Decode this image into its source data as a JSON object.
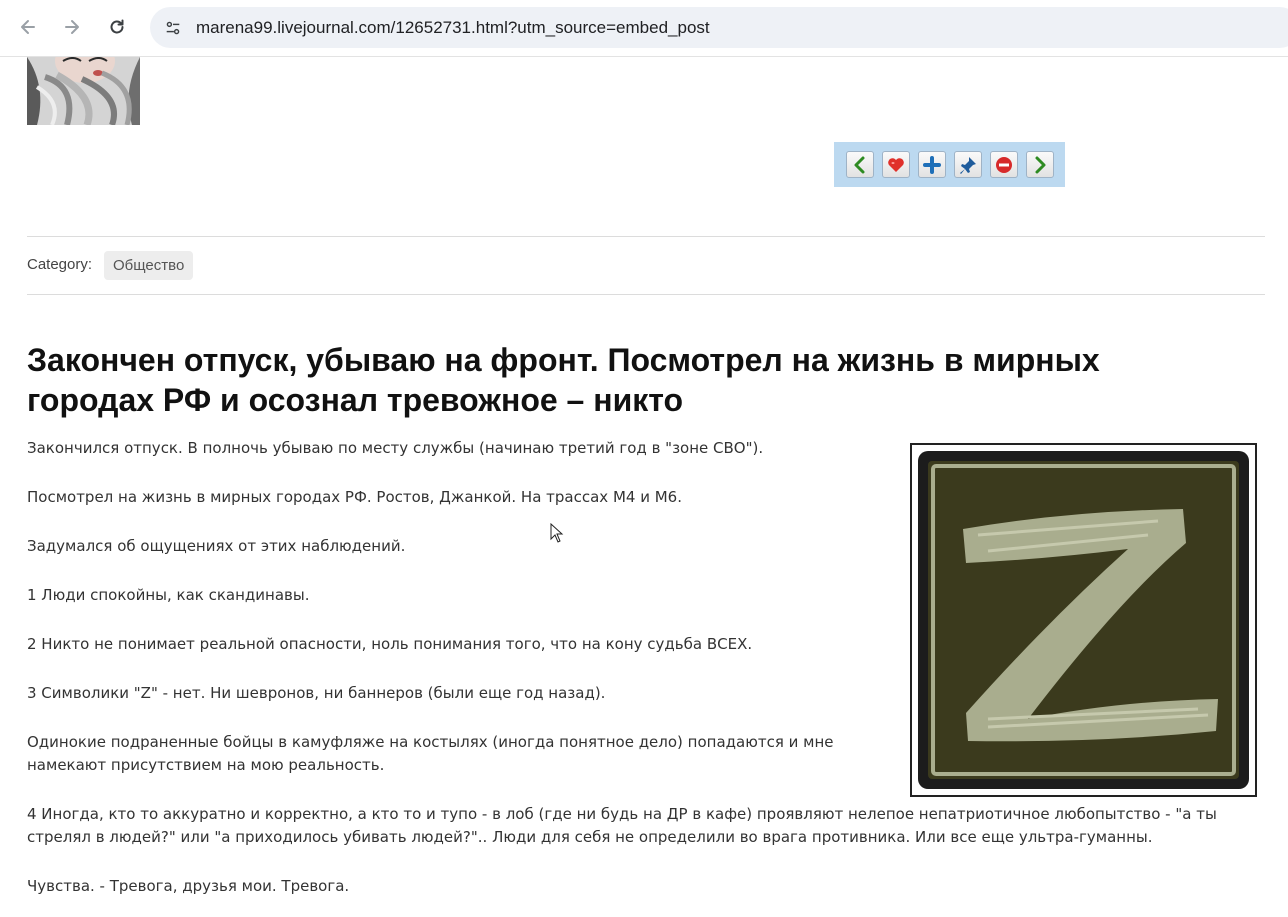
{
  "browser": {
    "url": "marena99.livejournal.com/12652731.html?utm_source=embed_post"
  },
  "toolbar": {
    "buttons": [
      "prev-icon",
      "heart-icon",
      "plus-icon",
      "pin-icon",
      "minus-icon",
      "next-icon"
    ]
  },
  "category": {
    "label": "Category:",
    "value": "Общество"
  },
  "article": {
    "title": "Закончен отпуск, убываю на фронт. Посмотрел на жизнь в мирных городах РФ и осознал тревожное – никто",
    "paragraphs": [
      "Закончился отпуск. В полночь убываю по месту службы (начинаю третий год в \"зоне СВО\").",
      "Посмотрел на жизнь в мирных городах РФ. Ростов, Джанкой. На трассах М4 и М6.",
      "Задумался об ощущениях от этих наблюдений.",
      "1 Люди спокойны, как скандинавы.",
      "2 Никто не понимает реальной опасности, ноль понимания того, что на кону судьба ВСЕХ.",
      "3 Символики \"Z\" - нет. Ни шевронов, ни баннеров (были еще год назад).",
      "Одинокие подраненные бойцы в камуфляже на костылях (иногда понятное дело) попадаются и мне намекают присутствием на мою реальность.",
      "4 Иногда, кто то аккуратно и корректно, а кто то и тупо - в лоб (где ни будь на ДР в кафе) проявляют нелепое непатриотичное любопытство - \"а ты стрелял в людей?\" или \"а приходилось убивать людей?\".. Люди для себя не определили во врага противника. Или все еще ультра-гуманны.",
      "Чувства. - Тревога, друзья мои. Тревога."
    ]
  },
  "colors": {
    "toolbar_bg": "#bcd9f0",
    "patch_border": "#1c1c1c",
    "patch_fill": "#3b3a1d",
    "patch_thread": "#a9ad8e"
  }
}
